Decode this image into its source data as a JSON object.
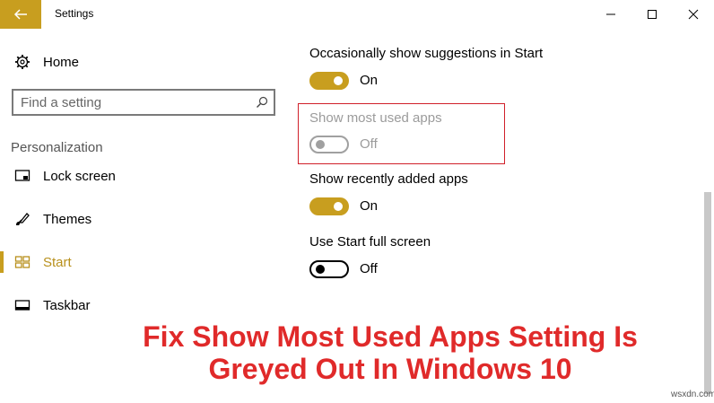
{
  "window": {
    "title": "Settings"
  },
  "sidebar": {
    "home_label": "Home",
    "search_placeholder": "Find a setting",
    "section_header": "Personalization",
    "items": [
      {
        "label": "Lock screen",
        "icon": "lock-screen-icon"
      },
      {
        "label": "Themes",
        "icon": "themes-icon"
      },
      {
        "label": "Start",
        "icon": "start-icon",
        "active": true
      },
      {
        "label": "Taskbar",
        "icon": "taskbar-icon"
      }
    ]
  },
  "settings": [
    {
      "label": "Occasionally show suggestions in Start",
      "state": "On",
      "enabled": true
    },
    {
      "label": "Show most used apps",
      "state": "Off",
      "enabled": false
    },
    {
      "label": "Show recently added apps",
      "state": "On",
      "enabled": true
    },
    {
      "label": "Use Start full screen",
      "state": "Off",
      "enabled": true
    }
  ],
  "overlay": {
    "headline_line1": "Fix Show Most Used Apps Setting Is",
    "headline_line2": "Greyed Out In Windows 10",
    "watermark": "wsxdn.com"
  },
  "colors": {
    "accent": "#c89e1f",
    "highlight": "#d0202a",
    "headline": "#e02a2a"
  }
}
